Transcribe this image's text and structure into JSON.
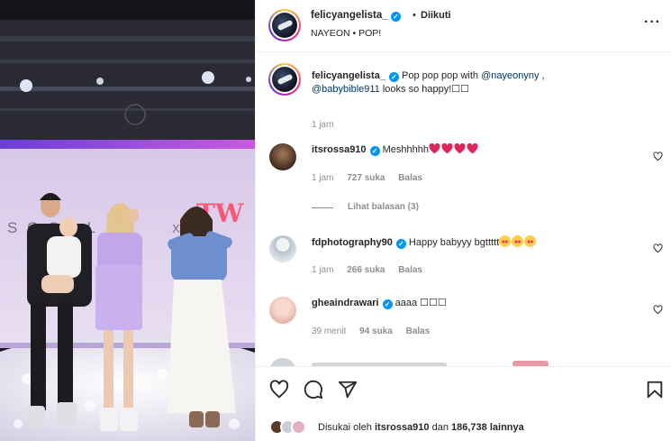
{
  "post": {
    "username": "felicyangelista_",
    "verified_mark": "✓",
    "separator": "•",
    "follow_status": "Diikuti",
    "audio": "NAYEON • POP!",
    "more_icon": "more-horizontal-icon"
  },
  "caption": {
    "username": "felicyangelista_",
    "text_part1": "Pop pop pop with ",
    "mention1": "@nayeonyny",
    "text_part2": " ,",
    "mention2": "@babybible911",
    "text_part3": " looks so happy!",
    "emoji_tail": "☐☐",
    "time": "1 jam"
  },
  "comments": [
    {
      "username": "itsrossa910",
      "text": "Meshhhhh",
      "emoji": [
        "red-heart",
        "red-heart",
        "red-heart",
        "red-heart"
      ],
      "time": "1 jam",
      "likes": "727 suka",
      "reply": "Balas",
      "view_replies": "Lihat balasan (3)"
    },
    {
      "username": "fdphotography90",
      "text": "Happy babyyy bgttttt",
      "emoji": [
        "star-struck",
        "star-struck",
        "star-struck"
      ],
      "time": "1 jam",
      "likes": "266 suka",
      "reply": "Balas"
    },
    {
      "username": "gheaindrawari",
      "text": "aaaa ☐☐☐",
      "time": "39 menit",
      "likes": "94 suka",
      "reply": "Balas"
    }
  ],
  "actions": {
    "like_icon": "heart-outline-icon",
    "comment_icon": "comment-icon",
    "share_icon": "share-send-icon",
    "save_icon": "bookmark-icon",
    "liked_by_prefix": "Disukai oleh",
    "liked_by_user": "itsrossa910",
    "liked_by_suffix": "dan",
    "liked_by_count": "186,738 lainnya"
  },
  "media": {
    "sign_text_left": "S C O L L",
    "sign_text_x": "X",
    "brand_text": "TW"
  },
  "colors": {
    "verified": "#0095f6",
    "mention": "#00376b",
    "meta_gray": "#8e8e8e",
    "heart_red": "#e0245e"
  }
}
